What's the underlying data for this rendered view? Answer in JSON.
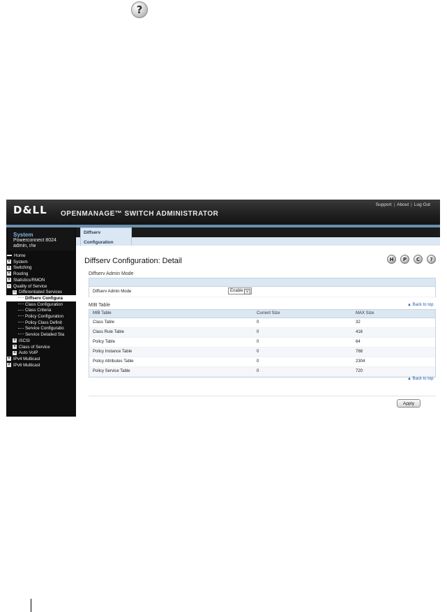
{
  "doc": {
    "help_glyph": "?"
  },
  "header": {
    "logo": "D&LL",
    "product": "OPENMANAGE™ SWITCH ADMINISTRATOR",
    "links": [
      "Support",
      "About",
      "Log Out"
    ]
  },
  "system": {
    "title": "System",
    "model": "Powerconnect 8024",
    "user": "admin, r/w"
  },
  "nav": [
    {
      "label": "Home",
      "type": "dash",
      "indent": 0
    },
    {
      "label": "System",
      "type": "plus",
      "indent": 0
    },
    {
      "label": "Switching",
      "type": "plus",
      "indent": 0
    },
    {
      "label": "Routing",
      "type": "plus",
      "indent": 0
    },
    {
      "label": "Statistics/RMON",
      "type": "plus",
      "indent": 0
    },
    {
      "label": "Quality of Service",
      "type": "minus",
      "indent": 0
    },
    {
      "label": "Differentiated Services",
      "type": "minus",
      "indent": 1
    },
    {
      "label": "Diffserv Configura",
      "type": "leaf",
      "indent": 2,
      "selected": true
    },
    {
      "label": "Class Configuration",
      "type": "leaf",
      "indent": 2
    },
    {
      "label": "Class Criteria",
      "type": "leaf",
      "indent": 2
    },
    {
      "label": "Policy Configuration",
      "type": "leaf",
      "indent": 2
    },
    {
      "label": "Policy Class Definit",
      "type": "leaf",
      "indent": 2
    },
    {
      "label": "Service Configuratio",
      "type": "leaf",
      "indent": 2
    },
    {
      "label": "Service Detailed Sta",
      "type": "leaf",
      "indent": 2
    },
    {
      "label": "iSCSI",
      "type": "plus",
      "indent": 1
    },
    {
      "label": "Class of Service",
      "type": "plus",
      "indent": 1
    },
    {
      "label": "Auto VoIP",
      "type": "plus",
      "indent": 1
    },
    {
      "label": "IPv4 Multicast",
      "type": "plus",
      "indent": 0
    },
    {
      "label": "IPv6 Multicast",
      "type": "plus",
      "indent": 0
    }
  ],
  "tab": {
    "label": "Diffserv Configuration"
  },
  "page": {
    "title": "Diffserv Configuration: Detail",
    "tools": [
      "H",
      "P",
      "C",
      "?"
    ],
    "admin_section": "Diffserv Admin Mode",
    "admin_label": "Diffserv Admin Mode",
    "admin_value": "Enable",
    "admin_arrow": "v",
    "mib_section": "MIB Table",
    "back_to_top": "▲ Back to top",
    "apply": "Apply"
  },
  "mib_table": {
    "headers": [
      "MIB Table",
      "Current Size",
      "MAX Size"
    ],
    "rows": [
      [
        "Class Table",
        "0",
        "32"
      ],
      [
        "Class Rule Table",
        "0",
        "416"
      ],
      [
        "Policy Table",
        "0",
        "64"
      ],
      [
        "Policy Instance Table",
        "0",
        "768"
      ],
      [
        "Policy Attributes Table",
        "0",
        "2304"
      ],
      [
        "Policy Service Table",
        "0",
        "720"
      ]
    ]
  }
}
